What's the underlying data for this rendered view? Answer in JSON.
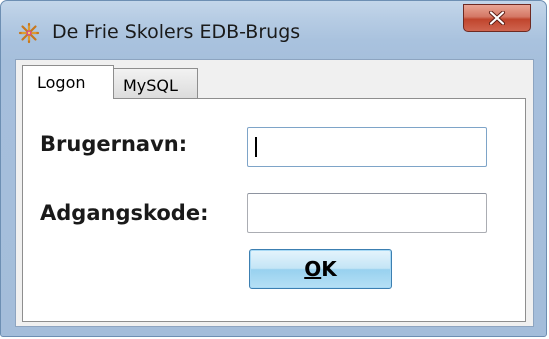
{
  "window": {
    "title": "De Frie Skolers EDB-Brugs",
    "app_icon": "snowflake-icon",
    "close_icon": "close-icon",
    "close_color": "#c0452d"
  },
  "tabs": [
    {
      "label": "Logon",
      "selected": true
    },
    {
      "label": "MySQL",
      "selected": false
    }
  ],
  "form": {
    "username_label": "Brugernavn:",
    "username_value": "",
    "password_label": "Adgangskode:",
    "password_value": "",
    "ok_mnemonic": "O",
    "ok_rest": "K"
  }
}
